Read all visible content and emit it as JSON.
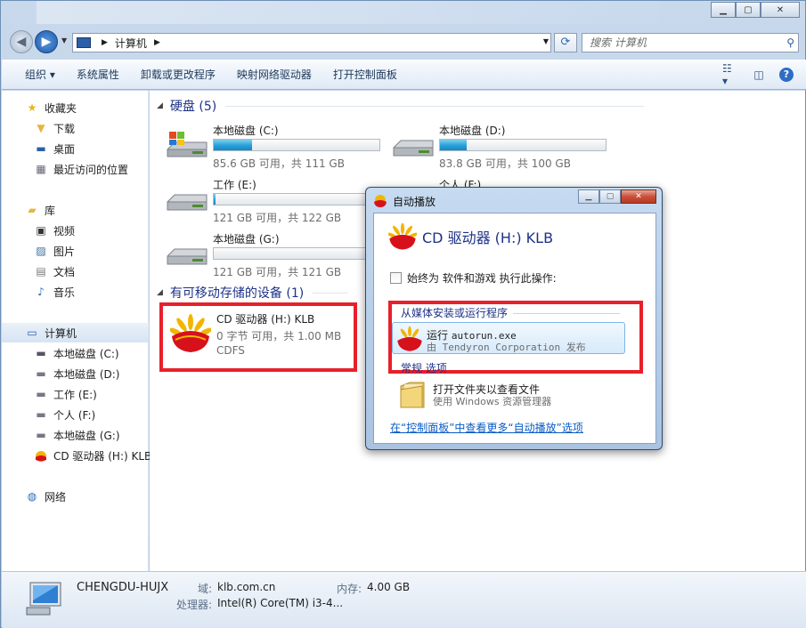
{
  "window": {
    "address": "计算机",
    "search_placeholder": "搜索 计算机"
  },
  "toolbar": {
    "organize": "组织 ▾",
    "system_props": "系统属性",
    "uninstall": "卸载或更改程序",
    "map_drive": "映射网络驱动器",
    "control_panel": "打开控制面板"
  },
  "nav": {
    "favorites": "收藏夹",
    "downloads": "下载",
    "desktop": "桌面",
    "recent": "最近访问的位置",
    "libraries": "库",
    "videos": "视频",
    "pictures": "图片",
    "documents": "文档",
    "music": "音乐",
    "computer": "计算机",
    "drive_c": "本地磁盘 (C:)",
    "drive_d": "本地磁盘 (D:)",
    "drive_e": "工作 (E:)",
    "drive_f": "个人 (F:)",
    "drive_g": "本地磁盘 (G:)",
    "drive_h": "CD 驱动器 (H:) KLB",
    "network": "网络"
  },
  "groups": {
    "hdd": "硬盘 (5)",
    "removable": "有可移动存储的设备 (1)"
  },
  "drives": [
    {
      "name": "本地磁盘 (C:)",
      "free": "85.6 GB 可用，共 111 GB",
      "used_fraction": 0.23
    },
    {
      "name": "本地磁盘 (D:)",
      "free": "83.8 GB 可用，共 100 GB",
      "used_fraction": 0.16
    },
    {
      "name": "工作 (E:)",
      "free": "121 GB 可用，共 122 GB",
      "used_fraction": 0.01
    },
    {
      "name": "个人 (F:)",
      "free": "",
      "used_fraction": 0.0
    },
    {
      "name": "本地磁盘 (G:)",
      "free": "121 GB 可用，共 121 GB",
      "used_fraction": 0.0
    }
  ],
  "cd": {
    "name": "CD 驱动器 (H:) KLB",
    "free": "0 字节 可用，共 1.00 MB",
    "fs": "CDFS"
  },
  "details": {
    "pcname": "CHENGDU-HUJX",
    "domain_label": "域:",
    "domain": "klb.com.cn",
    "mem_label": "内存:",
    "mem": "4.00 GB",
    "cpu_label": "处理器:",
    "cpu": "Intel(R) Core(TM) i3-4..."
  },
  "autoplay": {
    "title": "自动播放",
    "heading": "CD 驱动器 (H:) KLB",
    "always_label": "始终为 软件和游戏 执行此操作:",
    "section_install": "从媒体安装或运行程序",
    "run_line1": "运行",
    "run_file": "autorun.exe",
    "run_line2": "由 Tendyron Corporation 发布",
    "section_general": "常规 选项",
    "open_line1": "打开文件夹以查看文件",
    "open_line2": "使用 Windows 资源管理器",
    "cp_link": "在“控制面板”中查看更多“自动播放”选项"
  },
  "colors": {
    "accent": "#1e3287",
    "highlight": "#e8202a",
    "bar_fill": "#26a0da"
  }
}
